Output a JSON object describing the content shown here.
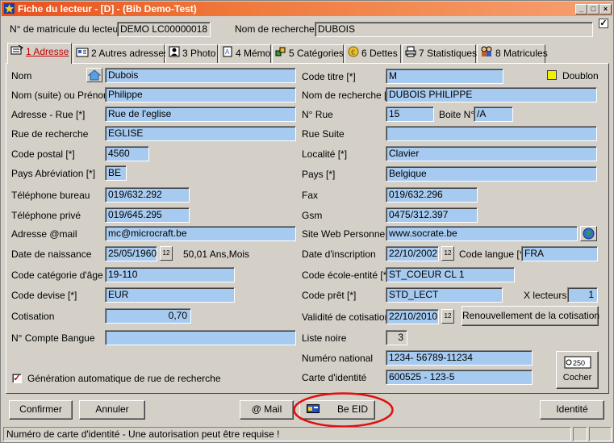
{
  "window": {
    "title": "Fiche du lecteur - [D] - (Bib Demo-Test)",
    "buttons": {
      "minimize": "_",
      "maximize": "□",
      "close": "×"
    }
  },
  "header": {
    "matricule_label": "N° de matricule du lecteur",
    "matricule_value": "DEMO LC00000018",
    "nom_recherche_label": "Nom de recherche",
    "nom_recherche_value": "DUBOIS",
    "corner_check": "✓"
  },
  "tabs": [
    {
      "label": "1 Adresse",
      "icon": "book-icon"
    },
    {
      "label": "2 Autres adresses",
      "icon": "address-card-icon"
    },
    {
      "label": "3 Photo",
      "icon": "photo-icon"
    },
    {
      "label": "4 Mémo",
      "icon": "memo-icon"
    },
    {
      "label": "5 Catégories",
      "icon": "categories-icon"
    },
    {
      "label": "6 Dettes",
      "icon": "coins-icon"
    },
    {
      "label": "7 Statistiques",
      "icon": "printer-icon"
    },
    {
      "label": "8 Matricules",
      "icon": "people-icon"
    }
  ],
  "left": {
    "nom": {
      "label": "Nom",
      "value": "Dubois"
    },
    "prenom": {
      "label": "Nom (suite) ou Prénom",
      "value": "Philippe"
    },
    "rue": {
      "label": "Adresse - Rue [*]",
      "value": "Rue de l'eglise"
    },
    "rue_recherche": {
      "label": "Rue de recherche",
      "value": "EGLISE"
    },
    "code_postal": {
      "label": "Code postal [*]",
      "value": "4560"
    },
    "pays_abrev": {
      "label": "Pays Abréviation [*]",
      "value": "BE"
    },
    "tel_bureau": {
      "label": "Téléphone bureau",
      "value": "019/632.292"
    },
    "tel_prive": {
      "label": "Téléphone privé",
      "value": "019/645.295"
    },
    "email": {
      "label": "Adresse @mail",
      "value": "mc@microcraft.be"
    },
    "naissance": {
      "label": "Date de naissance",
      "value": "25/05/1960",
      "age": "50,01 Ans,Mois"
    },
    "cat_age": {
      "label": "Code catégorie d'âge [*]",
      "value": "19-110"
    },
    "devise": {
      "label": "Code devise [*]",
      "value": "EUR"
    },
    "cotisation": {
      "label": "Cotisation",
      "value": "0,70"
    },
    "compte": {
      "label": "N° Compte Bangue",
      "value": ""
    },
    "gen_auto": {
      "label": "Génération automatique de rue de recherche",
      "checked": "✓"
    }
  },
  "right": {
    "code_titre": {
      "label": "Code titre [*]",
      "value": "M"
    },
    "doublon": {
      "label": "Doublon"
    },
    "nom_recherche": {
      "label": "Nom de recherche [*]",
      "value": "DUBOIS PHILIPPE"
    },
    "num_rue": {
      "label": "N° Rue",
      "value": "15"
    },
    "boite": {
      "label": "Boite N°",
      "value": "/A"
    },
    "rue_suite": {
      "label": "Rue Suite",
      "value": ""
    },
    "localite": {
      "label": "Localité [*]",
      "value": "Clavier"
    },
    "pays": {
      "label": "Pays [*]",
      "value": "Belgique"
    },
    "fax": {
      "label": "Fax",
      "value": "019/632.296"
    },
    "gsm": {
      "label": "Gsm",
      "value": "0475/312.397"
    },
    "site_web": {
      "label": "Site Web Personnel",
      "value": "www.socrate.be"
    },
    "inscription": {
      "label": "Date d'inscription",
      "value": "22/10/2002"
    },
    "langue": {
      "label": "Code langue [*]",
      "value": "FRA"
    },
    "ecole": {
      "label": "Code école-entité [*]",
      "value": "ST_COEUR CL 1"
    },
    "pret": {
      "label": "Code prêt [*]",
      "value": "STD_LECT"
    },
    "x_lecteurs": {
      "label": "X lecteurs",
      "value": "1"
    },
    "validite": {
      "label": "Validité de cotisation",
      "value": "22/10/2010"
    },
    "renouvellement": "Renouvellement de la cotisation",
    "liste_noire": {
      "label": "Liste noire",
      "value": "3"
    },
    "numero_national": {
      "label": "Numéro national",
      "value": "1234- 56789-11234"
    },
    "carte_identite": {
      "label": "Carte d'identité",
      "value": "600525 - 123-5"
    },
    "cocher": {
      "label": "Cocher",
      "icon_text": "250"
    }
  },
  "footer": {
    "confirmer": "Confirmer",
    "annuler": "Annuler",
    "mail": "@ Mail",
    "be_eid": "Be EID",
    "identite": "Identité"
  },
  "status": {
    "text": "Numéro de carte d'identité - Une autorisation peut être requise !"
  },
  "colors": {
    "field": "#a6caf0",
    "title_start": "#e8501e",
    "highlight_ellipse": "#e01010",
    "face": "#d4d0c8"
  },
  "calendar_icon_text": "12"
}
